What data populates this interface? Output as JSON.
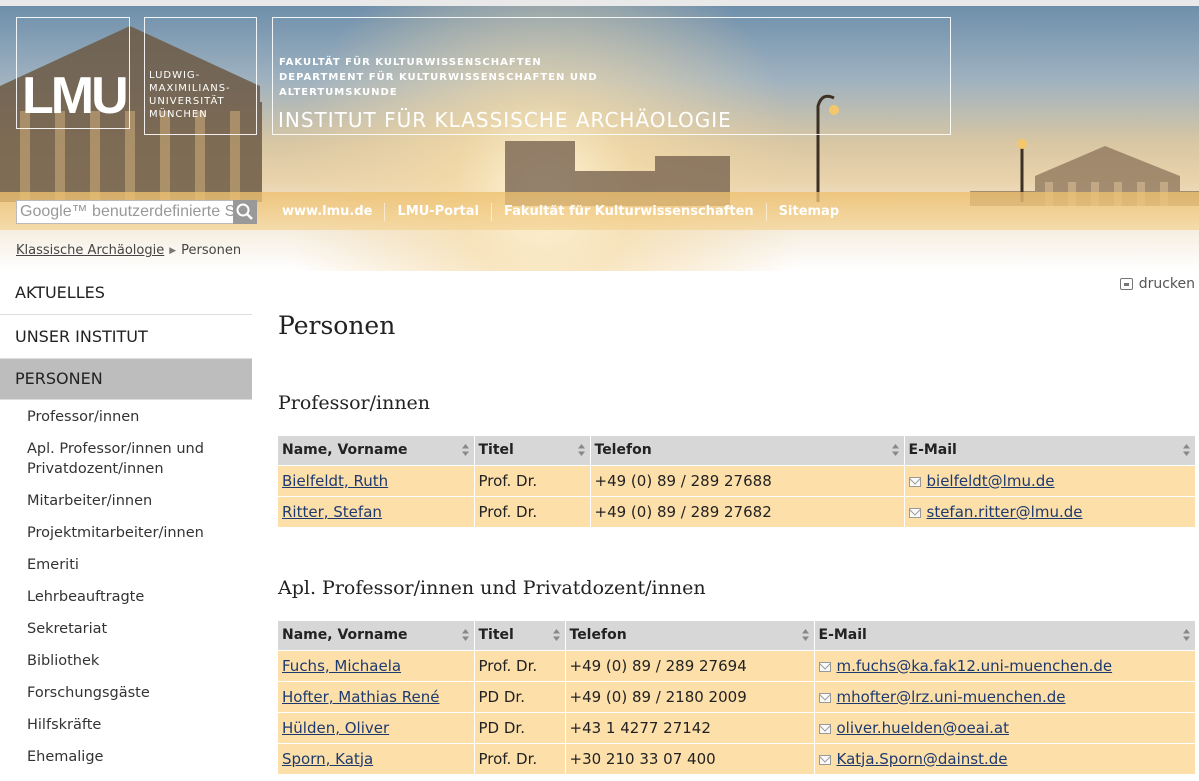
{
  "header": {
    "logo": "LMU",
    "university_lines": [
      "LUDWIG-",
      "MAXIMILIANS-",
      "UNIVERSITÄT",
      "MÜNCHEN"
    ],
    "faculty_lines": [
      "FAKULTÄT FÜR KULTURWISSENSCHAFTEN",
      "DEPARTMENT FÜR KULTURWISSENSCHAFTEN UND",
      "ALTERTUMSKUNDE"
    ],
    "institute": "INSTITUT FÜR KLASSISCHE ARCHÄOLOGIE"
  },
  "search": {
    "placeholder": "Google™ benutzerdefinierte Suche"
  },
  "top_nav": [
    "www.lmu.de",
    "LMU-Portal",
    "Fakultät für Kulturwissenschaften",
    "Sitemap"
  ],
  "breadcrumb": {
    "parent": "Klassische Archäologie",
    "current": "Personen"
  },
  "print_label": "drucken",
  "sidebar": {
    "main_items": [
      "AKTUELLES",
      "UNSER INSTITUT",
      "PERSONEN"
    ],
    "sub_items": [
      "Professor/innen",
      "Apl. Professor/innen und Privatdozent/innen",
      "Mitarbeiter/innen",
      "Projektmitarbeiter/innen",
      "Emeriti",
      "Lehrbeauftragte",
      "Sekretariat",
      "Bibliothek",
      "Forschungsgäste",
      "Hilfskräfte",
      "Ehemalige"
    ]
  },
  "page_title": "Personen",
  "columns": [
    "Name, Vorname",
    "Titel",
    "Telefon",
    "E-Mail"
  ],
  "sections": [
    {
      "heading": "Professor/innen",
      "rows": [
        {
          "name": "Bielfeldt, Ruth",
          "title": "Prof. Dr.",
          "phone": "+49 (0) 89 / 289 27688",
          "email": "bielfeldt@lmu.de"
        },
        {
          "name": "Ritter, Stefan",
          "title": "Prof. Dr.",
          "phone": "+49 (0) 89 / 289 27682",
          "email": "stefan.ritter@lmu.de"
        }
      ]
    },
    {
      "heading": "Apl. Professor/innen und Privatdozent/innen",
      "rows": [
        {
          "name": "Fuchs, Michaela",
          "title": "Prof. Dr.",
          "phone": "+49 (0) 89 / 289 27694",
          "email": "m.fuchs@ka.fak12.uni-muenchen.de"
        },
        {
          "name": "Hofter, Mathias René",
          "title": "PD Dr.",
          "phone": "+49 (0) 89 / 2180 2009",
          "email": "mhofter@lrz.uni-muenchen.de"
        },
        {
          "name": "Hülden, Oliver",
          "title": "PD Dr.",
          "phone": "+43 1 4277 27142",
          "email": "oliver.huelden@oeai.at"
        },
        {
          "name": "Sporn, Katja",
          "title": "Prof. Dr.",
          "phone": "+30 210 33 07 400",
          "email": "Katja.Sporn@dainst.de"
        }
      ]
    }
  ],
  "colors": {
    "row_bg": "#fddfaa",
    "header_bg": "#d7d7d7",
    "active_nav_bg": "#bdbdbd",
    "nav_bar": "#eec06e"
  }
}
